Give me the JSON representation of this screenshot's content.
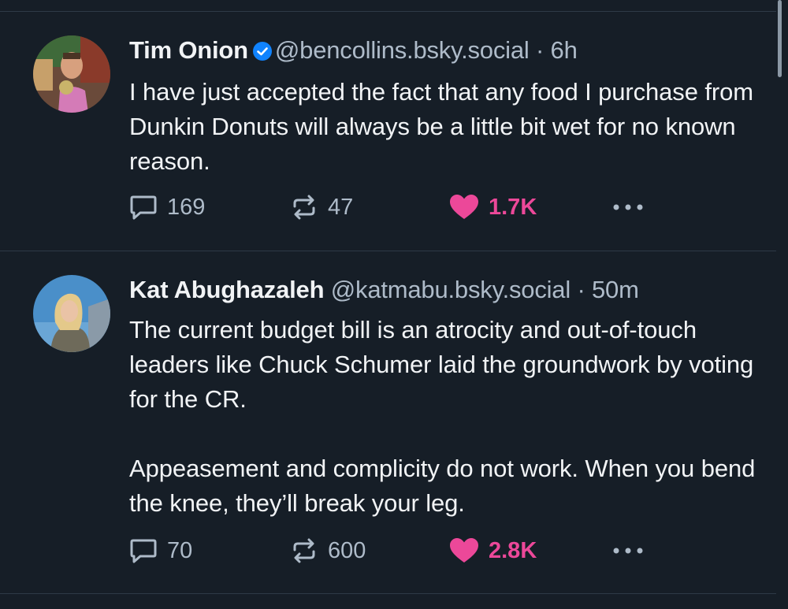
{
  "posts": [
    {
      "author": "Tim Onion",
      "handle": "@bencollins.bsky.social",
      "separator": "·",
      "time": "6h",
      "verified": true,
      "text": "I have just accepted the fact that any food I purchase from Dunkin Donuts will always be a little bit wet for no known reason.",
      "replies": "169",
      "reposts": "47",
      "likes": "1.7K",
      "avatar_icon": "avatar-photo"
    },
    {
      "author": "Kat Abughazaleh",
      "handle": "@katmabu.bsky.social",
      "separator": "·",
      "time": "50m",
      "verified": false,
      "text": "The current budget bill is an atrocity and out-of-touch leaders like Chuck Schumer laid the groundwork by voting for the CR.\n\nAppeasement and complicity do not work. When you bend the knee, they’ll break your leg.",
      "replies": "70",
      "reposts": "600",
      "likes": "2.8K",
      "avatar_icon": "avatar-photo"
    }
  ],
  "colors": {
    "background": "#161e27",
    "like": "#ec4899",
    "verified": "#1083fe",
    "muted": "#aebbc9"
  }
}
